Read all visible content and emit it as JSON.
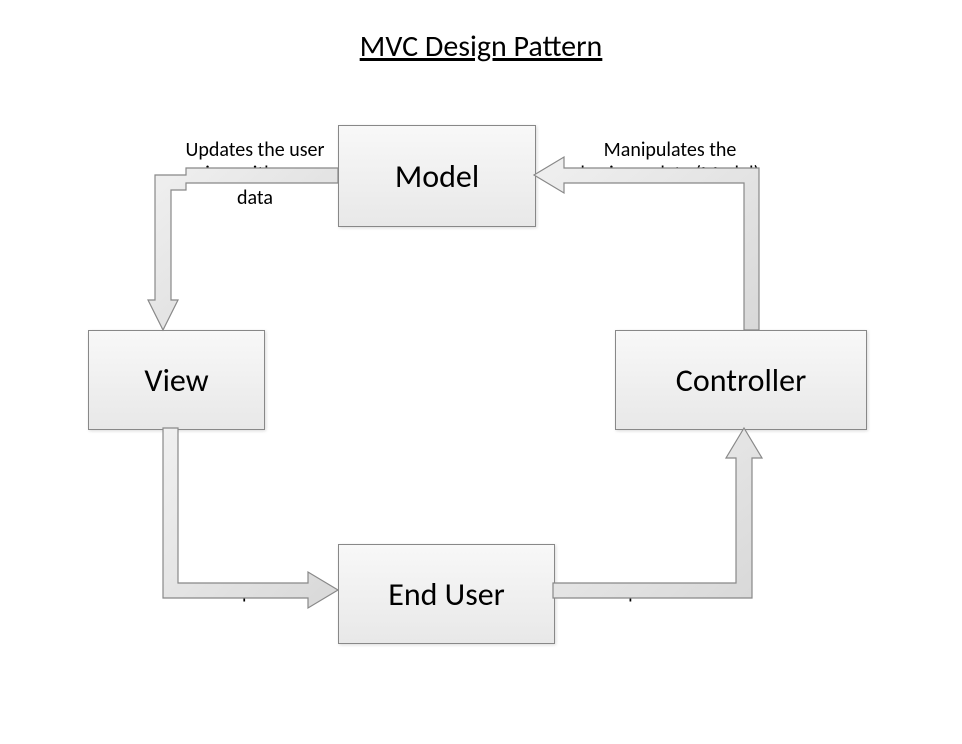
{
  "title": "MVC Design Pattern",
  "boxes": {
    "model": "Model",
    "view": "View",
    "controller": "Controller",
    "enduser": "End User"
  },
  "labels": {
    "updates": "Updates the user view with new data",
    "manipulates": "Manipulates the business data (Model)",
    "response": "Response",
    "request": "Request"
  }
}
